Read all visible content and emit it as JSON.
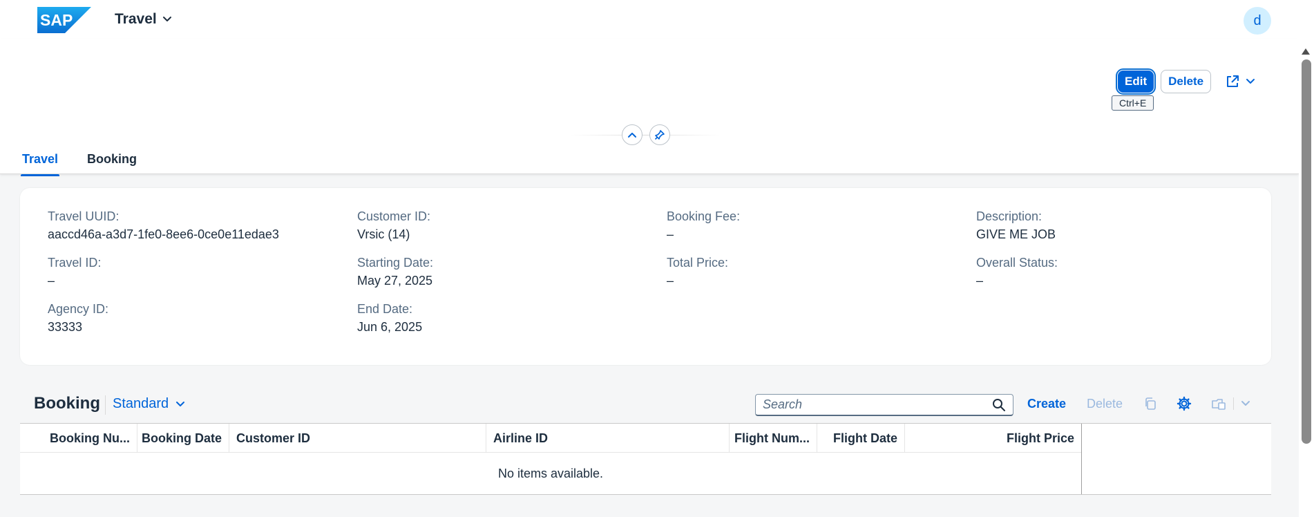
{
  "shell": {
    "app_title": "Travel",
    "avatar_initial": "d",
    "logo_text": "SAP"
  },
  "header": {
    "edit_label": "Edit",
    "delete_label": "Delete",
    "edit_tooltip": "Ctrl+E",
    "tabs": [
      {
        "label": "Travel",
        "active": true
      },
      {
        "label": "Booking",
        "active": false
      }
    ]
  },
  "details": {
    "col1": [
      {
        "label": "Travel UUID:",
        "value": "aaccd46a-a3d7-1fe0-8ee6-0ce0e11edae3"
      },
      {
        "label": "Travel ID:",
        "value": "–"
      },
      {
        "label": "Agency ID:",
        "value": "33333"
      }
    ],
    "col2": [
      {
        "label": "Customer ID:",
        "value": "Vrsic (14)"
      },
      {
        "label": "Starting Date:",
        "value": "May 27, 2025"
      },
      {
        "label": "End Date:",
        "value": "Jun 6, 2025"
      }
    ],
    "col3": [
      {
        "label": "Booking Fee:",
        "value": "–"
      },
      {
        "label": "Total Price:",
        "value": "–"
      }
    ],
    "col4": [
      {
        "label": "Description:",
        "value": "GIVE ME JOB"
      },
      {
        "label": "Overall Status:",
        "value": "–"
      }
    ]
  },
  "booking": {
    "title": "Booking",
    "variant": "Standard",
    "search_placeholder": "Search",
    "create_label": "Create",
    "delete_label": "Delete",
    "columns": [
      "Booking Nu...",
      "Booking Date",
      "Customer ID",
      "Airline ID",
      "Flight Num...",
      "Flight Date",
      "Flight Price"
    ],
    "empty_text": "No items available."
  },
  "colors": {
    "accent": "#0064d9",
    "text": "#1d2d3e",
    "label": "#556b82",
    "background": "#f5f6f7"
  }
}
